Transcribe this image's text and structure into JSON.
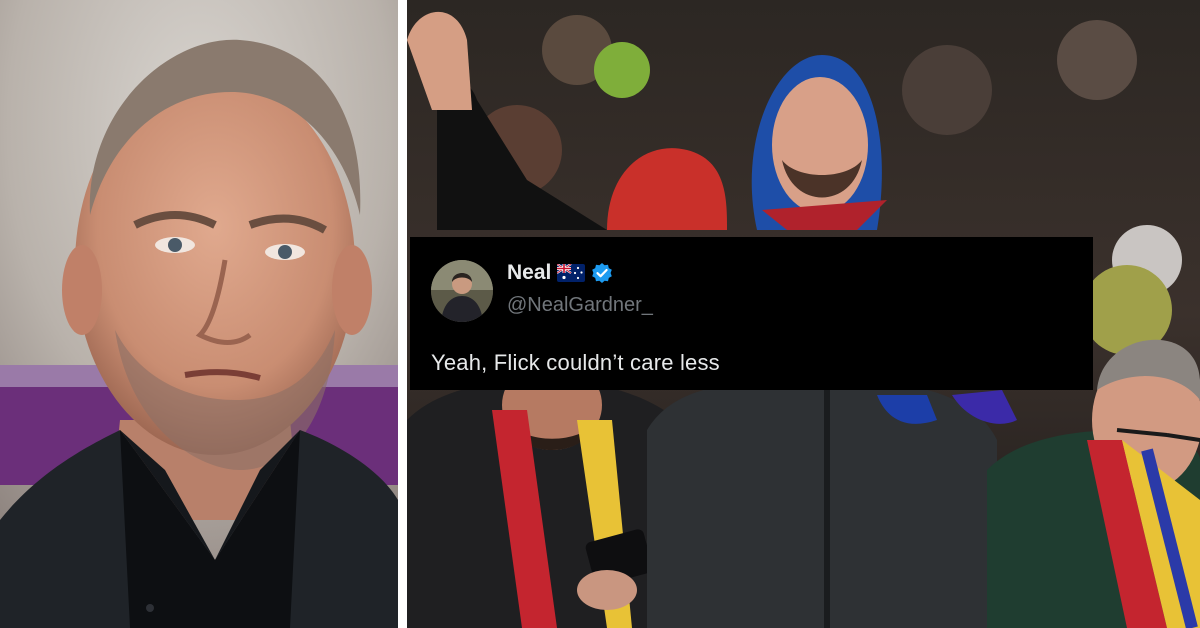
{
  "tweet": {
    "display_name": "Neal",
    "handle": "@NealGardner_",
    "text": "Yeah, Flick couldn’t care less",
    "flag_icon": "australia-flag-icon",
    "verified_icon": "verified-badge-icon",
    "verified_color": "#1d9bf0",
    "background": "#000000",
    "handle_color": "#71767b",
    "text_color": "#e7e9ea"
  },
  "photos": {
    "left": "coach-portrait-photo",
    "right": "stadium-fans-photo"
  }
}
